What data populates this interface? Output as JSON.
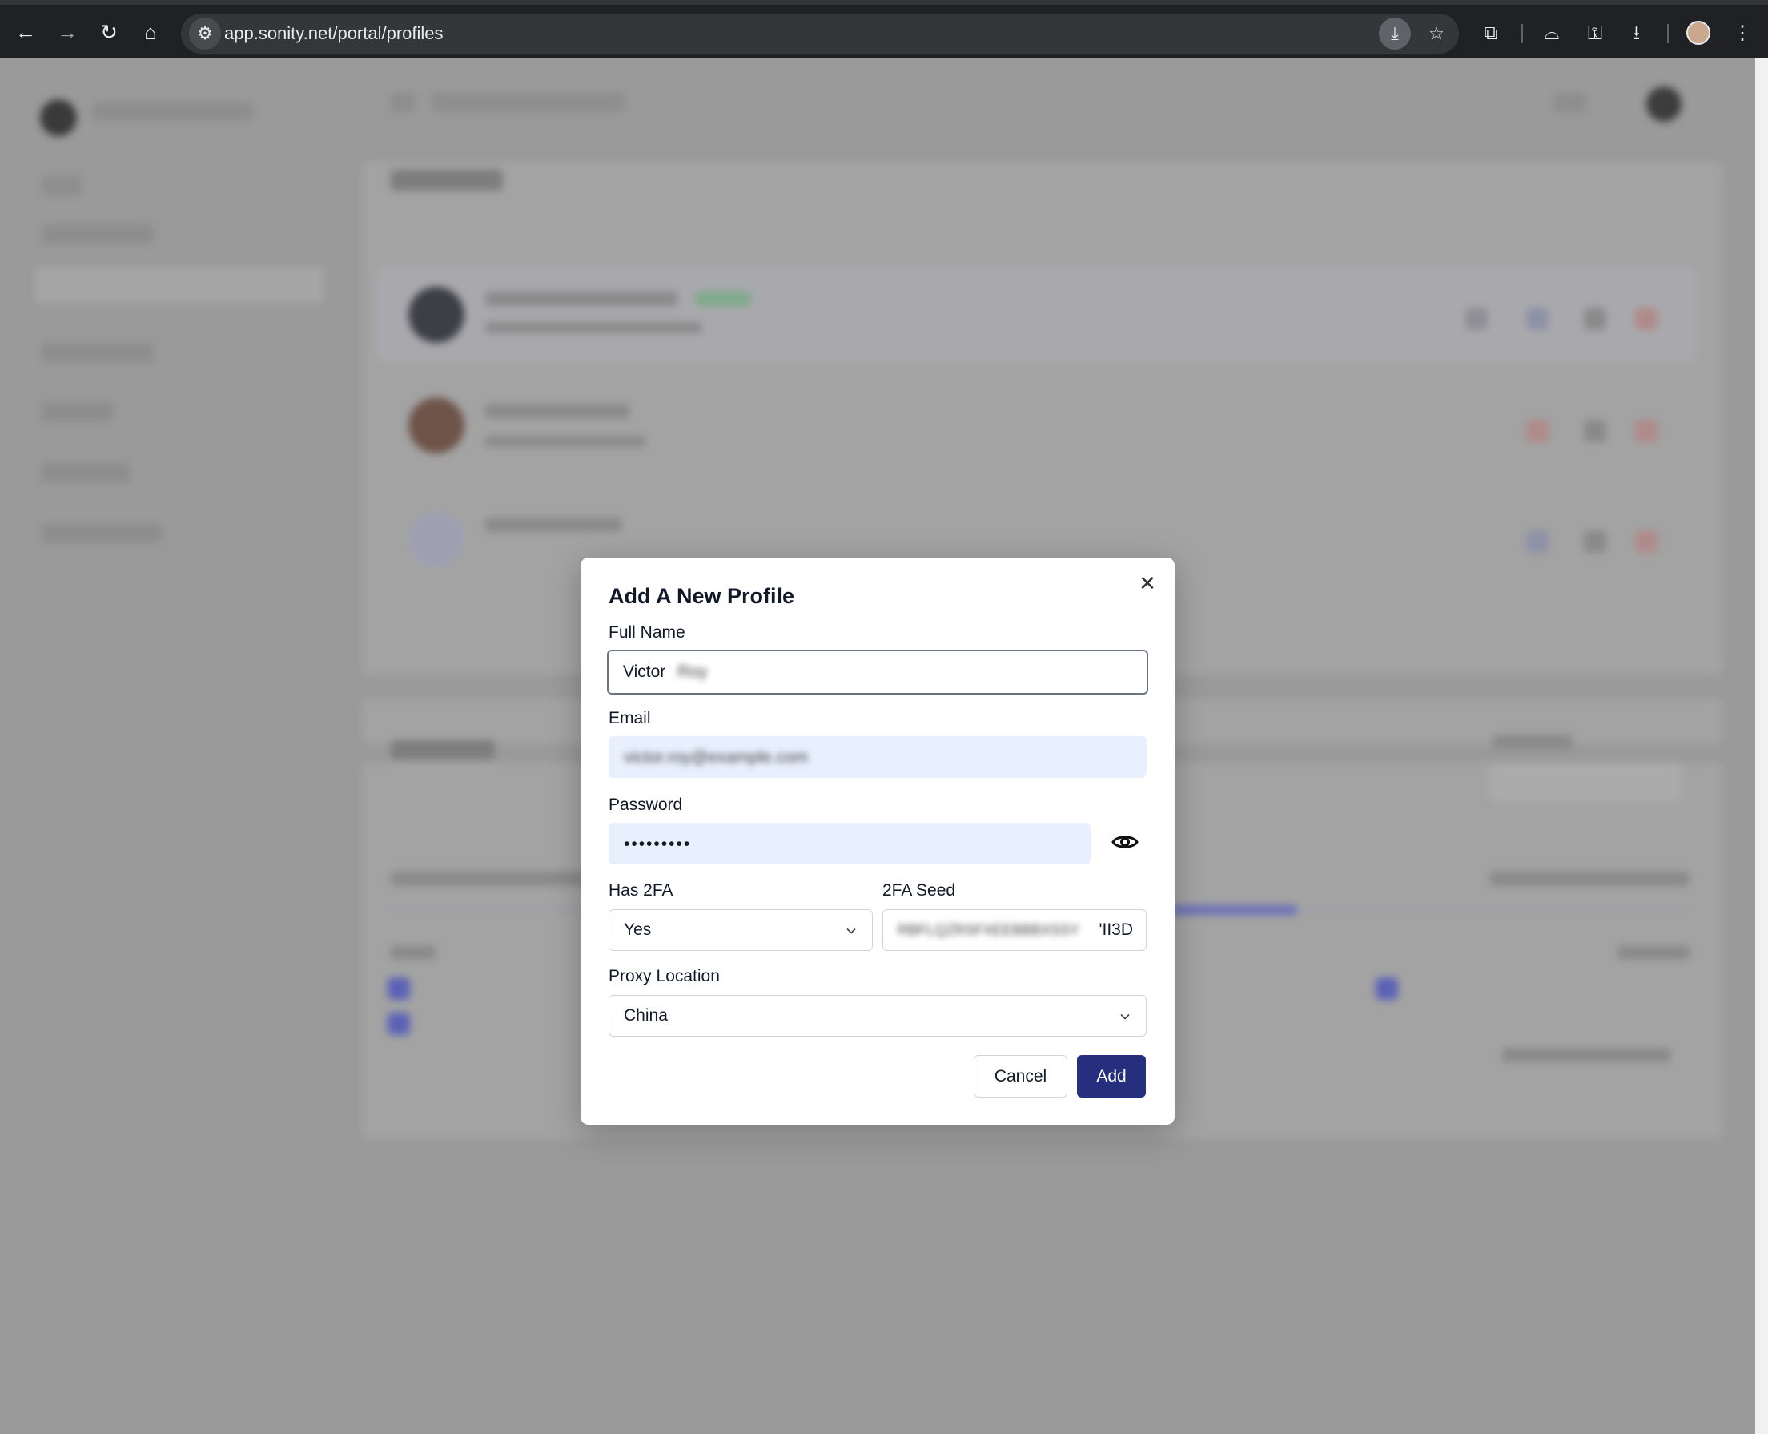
{
  "browser": {
    "url": "app.sonity.net/portal/profiles"
  },
  "modal": {
    "title": "Add A New Profile",
    "full_name": {
      "label": "Full Name",
      "value": "Victor",
      "value_hidden": "Roy"
    },
    "email": {
      "label": "Email",
      "value": "victor.roy@example.com"
    },
    "password": {
      "label": "Password",
      "value": "•••••••••"
    },
    "has_2fa": {
      "label": "Has 2FA",
      "value": "Yes"
    },
    "seed_2fa": {
      "label": "2FA Seed",
      "value_hidden": "RBFLQZRSFXEEBBBXSSY",
      "value_visible_tail": "'II3D"
    },
    "proxy_location": {
      "label": "Proxy Location",
      "value": "China"
    },
    "buttons": {
      "cancel": "Cancel",
      "add": "Add"
    }
  },
  "colors": {
    "primary": "#262e7e",
    "autofill": "#e8f0fe",
    "overlay": "#9a9a9a"
  },
  "icons": [
    "back-icon",
    "forward-icon",
    "reload-icon",
    "home-icon",
    "site-settings-icon",
    "install-app-icon",
    "bookmark-star-icon",
    "extensions-icon",
    "incognito-icon",
    "password-key-icon",
    "download-icon",
    "profile-avatar-icon",
    "more-menu-icon",
    "close-icon",
    "eye-icon",
    "chevron-down-icon"
  ]
}
